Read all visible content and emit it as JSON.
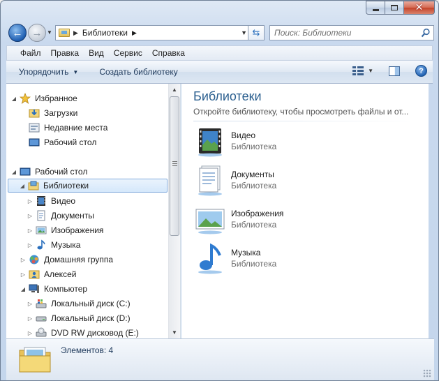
{
  "window": {
    "caption_buttons": {
      "minimize": "minimize-icon",
      "maximize": "maximize-icon",
      "close": "close-icon"
    }
  },
  "nav": {
    "breadcrumb": "Библиотеки",
    "search_placeholder": "Поиск: Библиотеки"
  },
  "menu": [
    "Файл",
    "Правка",
    "Вид",
    "Сервис",
    "Справка"
  ],
  "commands": {
    "organize": "Упорядочить",
    "create_library": "Создать библиотеку"
  },
  "tree": [
    {
      "label": "Избранное",
      "icon": "star-icon",
      "expander": "◢",
      "level": 0
    },
    {
      "label": "Загрузки",
      "icon": "downloads-folder-icon",
      "expander": "",
      "level": 1
    },
    {
      "label": "Недавние места",
      "icon": "recent-places-icon",
      "expander": "",
      "level": 1
    },
    {
      "label": "Рабочий стол",
      "icon": "desktop-icon",
      "expander": "",
      "level": 1
    },
    {
      "label": "Рабочий стол",
      "icon": "desktop-icon",
      "expander": "◢",
      "level": 0
    },
    {
      "label": "Библиотеки",
      "icon": "libraries-icon",
      "expander": "◢",
      "level": 1,
      "selected": true
    },
    {
      "label": "Видео",
      "icon": "video-icon",
      "expander": "▷",
      "level": 2
    },
    {
      "label": "Документы",
      "icon": "documents-icon",
      "expander": "▷",
      "level": 2
    },
    {
      "label": "Изображения",
      "icon": "pictures-icon",
      "expander": "▷",
      "level": 2
    },
    {
      "label": "Музыка",
      "icon": "music-icon",
      "expander": "▷",
      "level": 2
    },
    {
      "label": "Домашняя группа",
      "icon": "homegroup-icon",
      "expander": "▷",
      "level": 1
    },
    {
      "label": "Алексей",
      "icon": "user-folder-icon",
      "expander": "▷",
      "level": 1
    },
    {
      "label": "Компьютер",
      "icon": "computer-icon",
      "expander": "◢",
      "level": 1
    },
    {
      "label": "Локальный диск (C:)",
      "icon": "drive-c-icon",
      "expander": "▷",
      "level": 2
    },
    {
      "label": "Локальный диск (D:)",
      "icon": "drive-icon",
      "expander": "▷",
      "level": 2
    },
    {
      "label": "DVD RW дисковод (E:)",
      "icon": "dvd-drive-icon",
      "expander": "▷",
      "level": 2
    }
  ],
  "content": {
    "title": "Библиотеки",
    "subtitle": "Откройте библиотеку, чтобы просмотреть файлы и от...",
    "libraries": [
      {
        "name": "Видео",
        "kind": "Библиотека",
        "icon": "video-library-icon"
      },
      {
        "name": "Документы",
        "kind": "Библиотека",
        "icon": "documents-library-icon"
      },
      {
        "name": "Изображения",
        "kind": "Библиотека",
        "icon": "pictures-library-icon"
      },
      {
        "name": "Музыка",
        "kind": "Библиотека",
        "icon": "music-library-icon"
      }
    ]
  },
  "details": {
    "count_text": "Элементов: 4"
  }
}
